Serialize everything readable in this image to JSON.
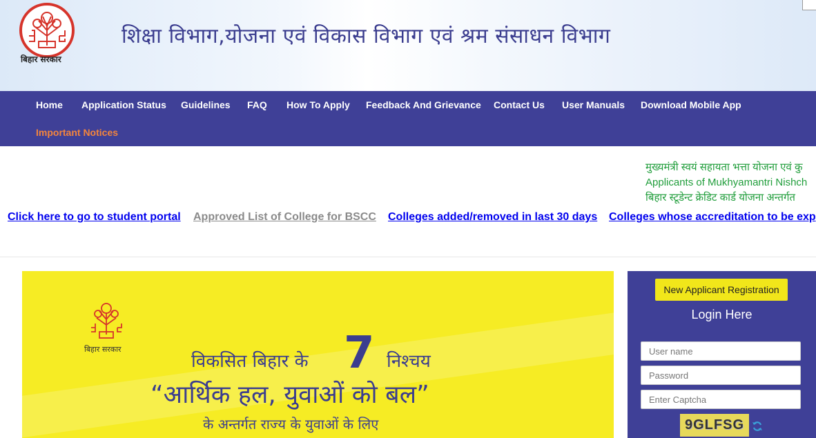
{
  "header": {
    "logo_text": "बिहार सरकार",
    "title": "शिक्षा विभाग,योजना एवं विकास विभाग एवं श्रम संसाधन विभाग"
  },
  "nav": {
    "items": [
      {
        "label": "Home"
      },
      {
        "label": "Application Status"
      },
      {
        "label": "Guidelines"
      },
      {
        "label": "FAQ"
      },
      {
        "label": "How To Apply"
      },
      {
        "label": "Feedback And Grievance"
      },
      {
        "label": "Contact Us"
      },
      {
        "label": "User Manuals"
      },
      {
        "label": "Download Mobile App"
      },
      {
        "label": "Important Notices"
      }
    ]
  },
  "marquee": {
    "lines": [
      "मुख्यमंत्री स्वयं सहायता भत्ता योजना एवं कु",
      "Applicants of Mukhyamantri Nishch",
      "बिहार स्टूडेन्ट क्रेडिट कार्ड योजना अन्तर्गत"
    ]
  },
  "links": [
    {
      "label": "Click here to go to student portal"
    },
    {
      "label": "Approved List of College for BSCC"
    },
    {
      "label": "Colleges added/removed in last 30 days"
    },
    {
      "label": "Colleges whose accreditation to be exp"
    }
  ],
  "banner": {
    "logo_text": "बिहार सरकार",
    "line1_pre": "विकसित बिहार के",
    "number": "7",
    "line1_post": "निश्चय",
    "line2": "“आर्थिक हल, युवाओं को बल”",
    "line3": "के अन्तर्गत राज्य के युवाओं के लिए"
  },
  "login": {
    "register_button": "New Applicant Registration",
    "title": "Login Here",
    "username_placeholder": "User name",
    "password_placeholder": "Password",
    "captcha_placeholder": "Enter Captcha",
    "captcha_text": "9GLFSG"
  },
  "colors": {
    "nav_bg": "#3f4097",
    "notice_orange": "#f4853c",
    "marquee_green": "#1f9d3a",
    "banner_yellow": "#f6ec24",
    "register_yellow": "#f1e61a",
    "title_blue": "#3b3d8f"
  }
}
